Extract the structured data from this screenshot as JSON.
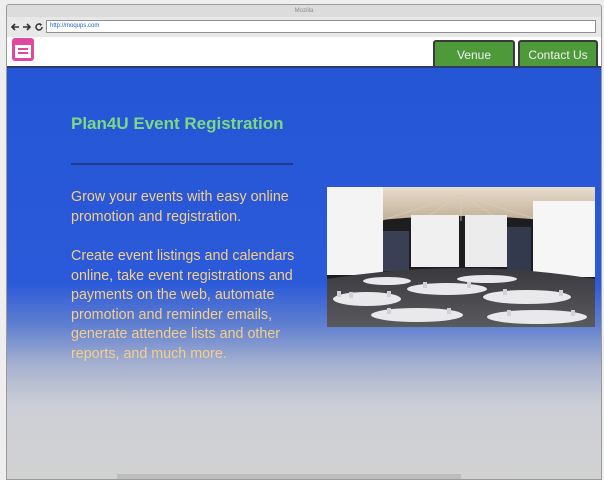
{
  "window": {
    "title": "Mozilla"
  },
  "browser": {
    "url": "http://moqups.com"
  },
  "nav": {
    "items": [
      {
        "label": "Venue"
      },
      {
        "label": "Contact Us"
      }
    ]
  },
  "content": {
    "title": "Plan4U Event Registration",
    "paragraph1": "Grow your events with easy online promotion and registration.",
    "paragraph2": "Create event listings and calendars online, take event registrations and payments on the web, automate promotion and reminder emails, generate attendee lists and other reports, and much more."
  },
  "colors": {
    "tab_green": "#4e9a3a",
    "title_green": "#7ed882",
    "body_text": "#f4cf8a",
    "background_blue": "#2456d6",
    "logo_pink": "#e0479e"
  },
  "icons": [
    "back-arrow-icon",
    "forward-arrow-icon",
    "reload-icon",
    "calendar-icon"
  ],
  "image": {
    "subject": "conference hall"
  }
}
